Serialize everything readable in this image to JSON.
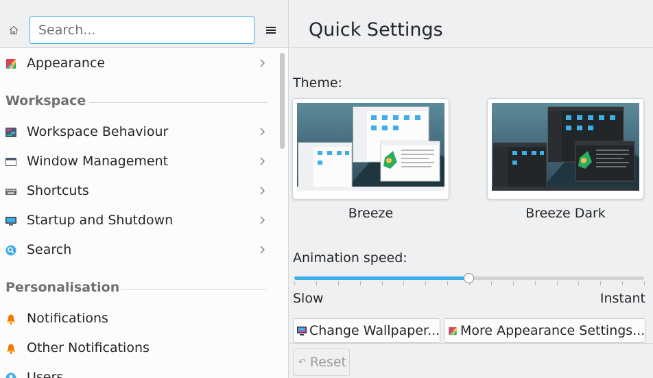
{
  "sidebar": {
    "search_placeholder": "Search...",
    "home_icon": "home-icon",
    "menu_icon": "hamburger-menu-icon",
    "items_top": [
      {
        "label": "Appearance",
        "icon": "appearance-icon"
      }
    ],
    "sections": [
      {
        "title": "Workspace",
        "items": [
          {
            "label": "Workspace Behaviour",
            "icon": "workspace-behaviour-icon"
          },
          {
            "label": "Window Management",
            "icon": "window-management-icon"
          },
          {
            "label": "Shortcuts",
            "icon": "keyboard-icon"
          },
          {
            "label": "Startup and Shutdown",
            "icon": "monitor-icon"
          },
          {
            "label": "Search",
            "icon": "search-icon"
          }
        ]
      },
      {
        "title": "Personalisation",
        "items": [
          {
            "label": "Notifications",
            "icon": "bell-icon"
          },
          {
            "label": "Other Notifications",
            "icon": "bell-icon"
          },
          {
            "label": "Users",
            "icon": "users-icon"
          }
        ]
      }
    ]
  },
  "main": {
    "title": "Quick Settings",
    "theme_label": "Theme:",
    "themes": [
      {
        "name": "Breeze",
        "style": "light"
      },
      {
        "name": "Breeze Dark",
        "style": "dark"
      }
    ],
    "animation_label": "Animation speed:",
    "slider": {
      "value_fraction": 0.5,
      "ticks": 17,
      "min_label": "Slow",
      "max_label": "Instant"
    },
    "buttons": {
      "wallpaper": "Change Wallpaper...",
      "more_appearance": "More Appearance Settings..."
    },
    "reset_label": "Reset"
  },
  "colors": {
    "accent": "#3daee9",
    "window_bg": "#eff0f1",
    "view_bg": "#fcfcfc",
    "text": "#232629",
    "section_title": "#6e7173"
  }
}
